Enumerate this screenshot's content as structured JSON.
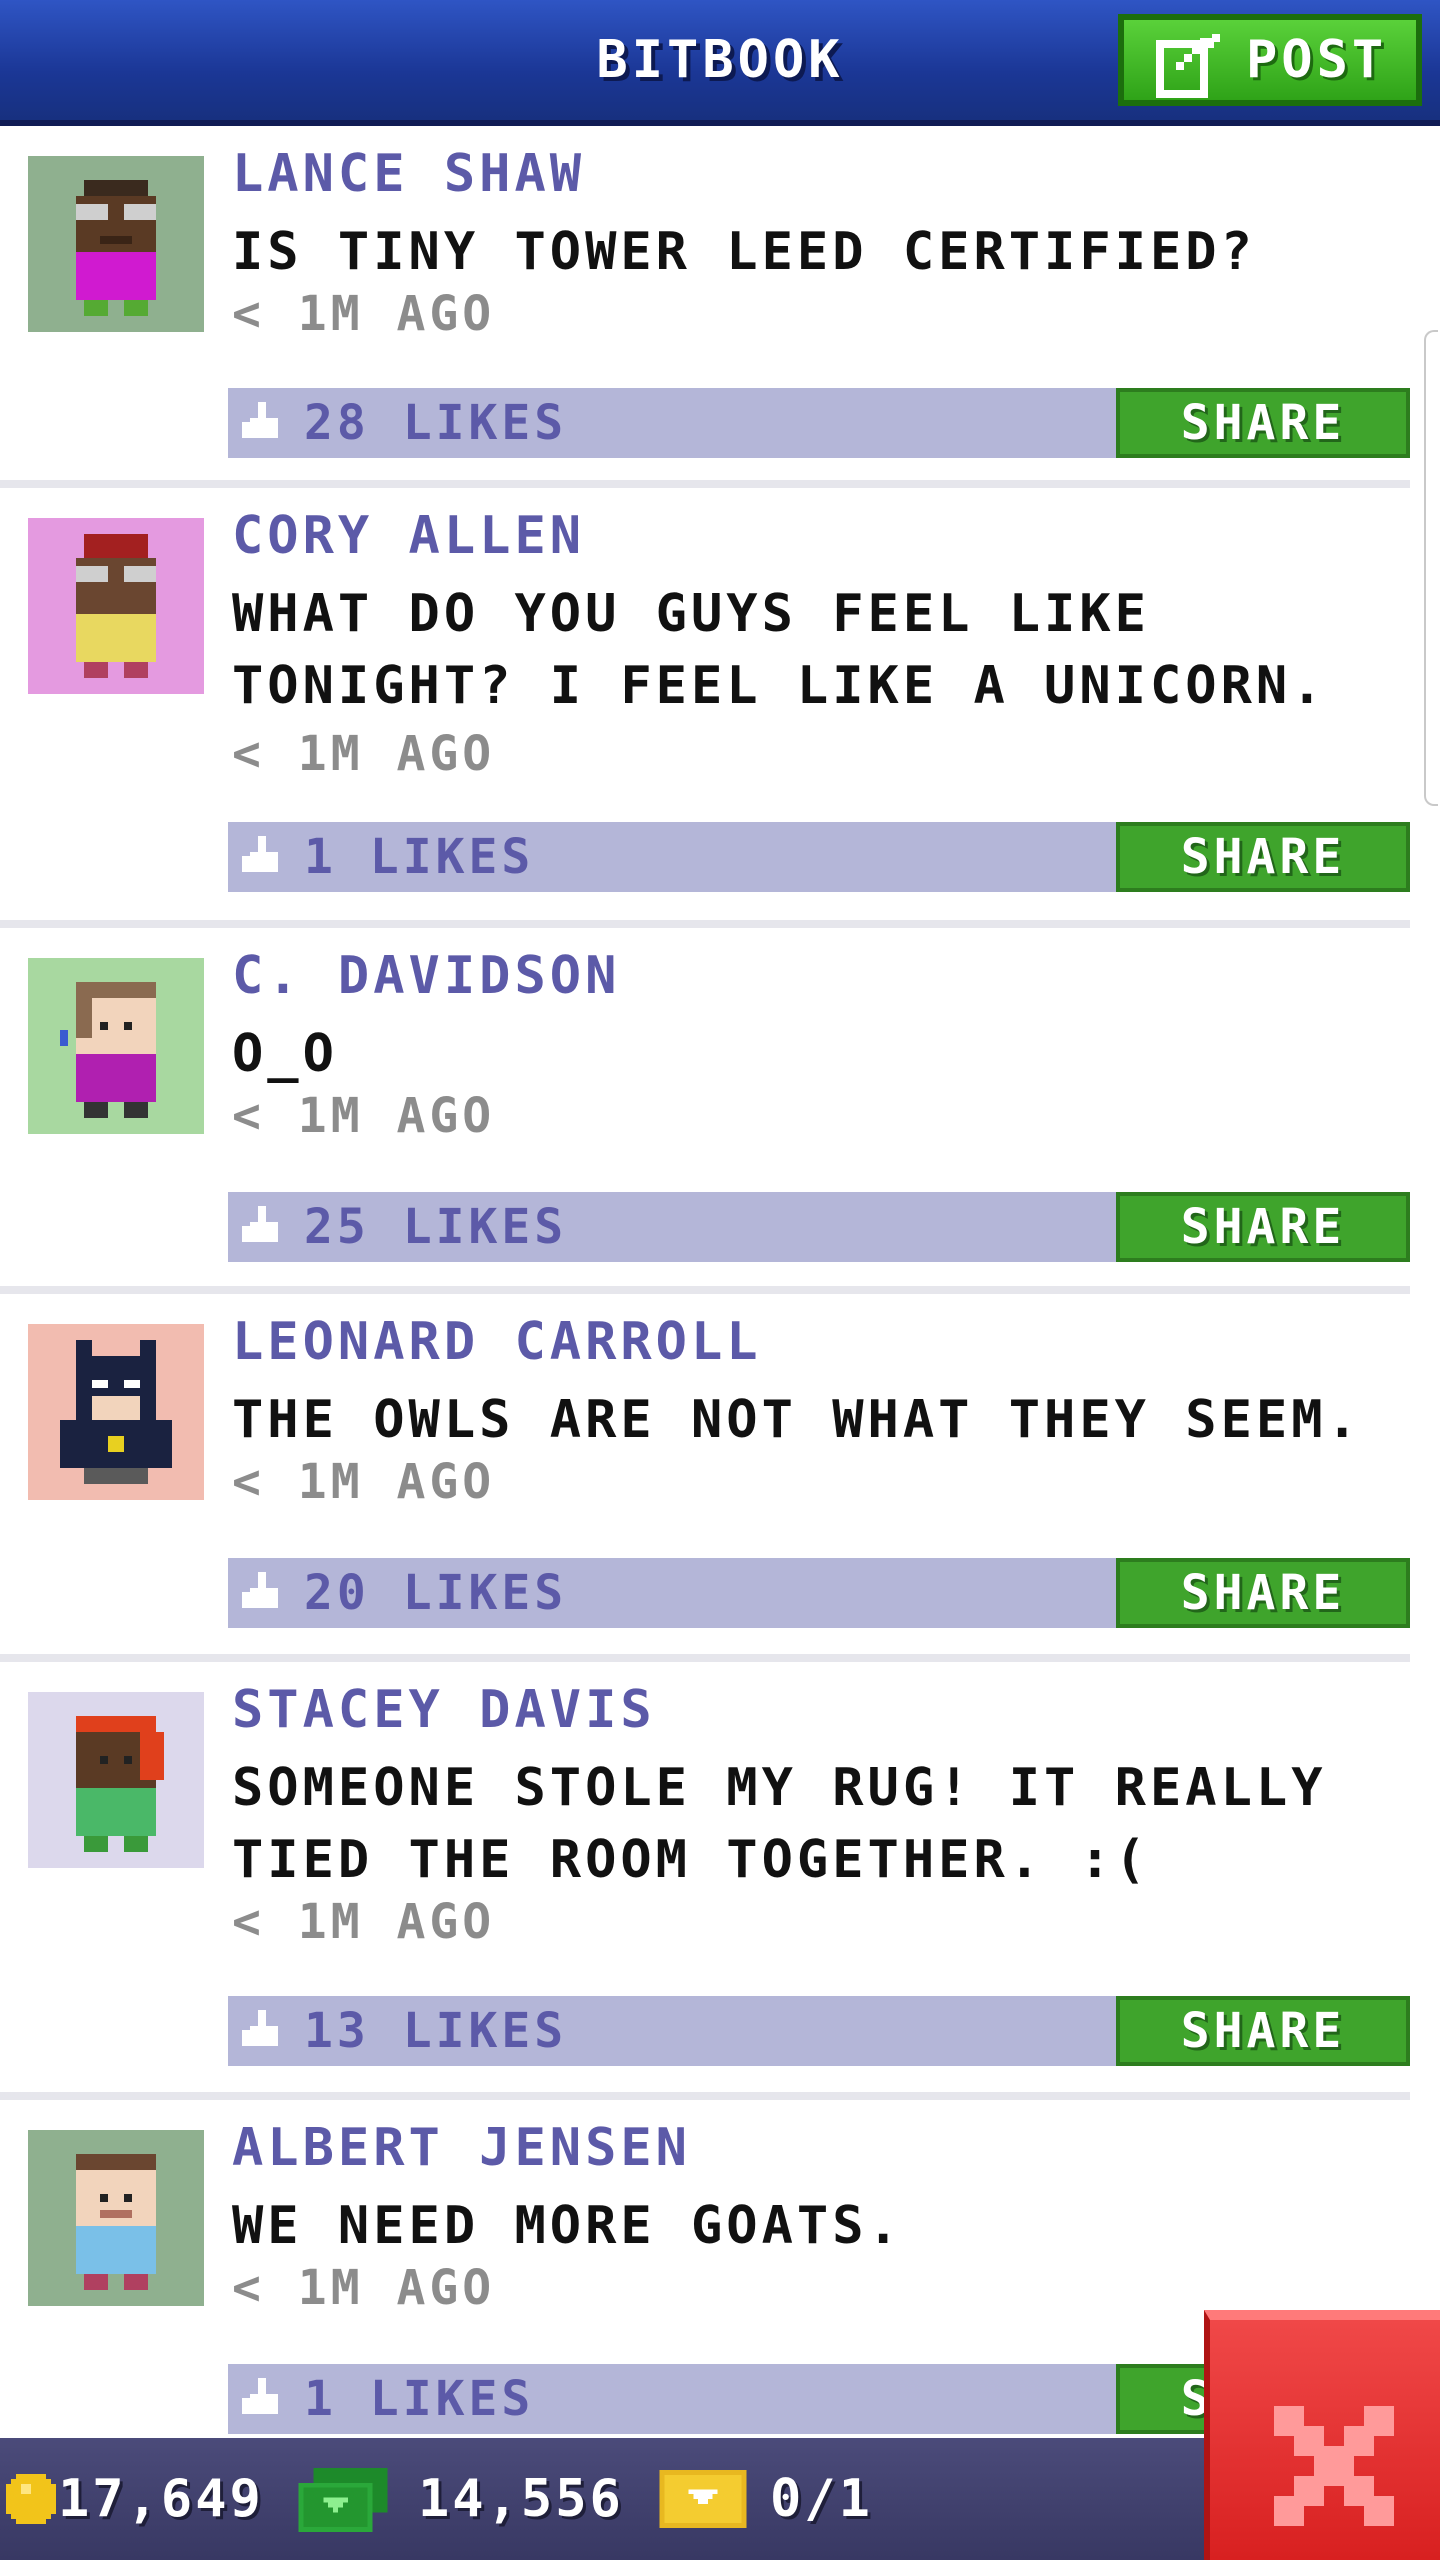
{
  "header": {
    "title": "BITBOOK",
    "post_label": "POST"
  },
  "posts": [
    {
      "author": "LANCE SHAW",
      "message": "IS TINY TOWER LEED CERTIFIED?",
      "time": "< 1M AGO",
      "likes": "28 LIKES",
      "share_label": "SHARE",
      "avatar_bg": "#8fb08f"
    },
    {
      "author": "CORY ALLEN",
      "message": "WHAT DO YOU GUYS FEEL LIKE TONIGHT? I FEEL LIKE A UNICORN.",
      "time": "< 1M AGO",
      "likes": "1 LIKES",
      "share_label": "SHARE",
      "avatar_bg": "#e49ae0"
    },
    {
      "author": "C. DAVIDSON",
      "message": "O_O",
      "time": "< 1M AGO",
      "likes": "25 LIKES",
      "share_label": "SHARE",
      "avatar_bg": "#a8d8a0"
    },
    {
      "author": "LEONARD CARROLL",
      "message": "THE OWLS ARE NOT WHAT THEY SEEM.",
      "time": "< 1M AGO",
      "likes": "20 LIKES",
      "share_label": "SHARE",
      "avatar_bg": "#f2bcb0"
    },
    {
      "author": "STACEY DAVIS",
      "message": "SOMEONE STOLE MY RUG! IT REALLY TIED THE ROOM TOGETHER. :(",
      "time": "< 1M AGO",
      "likes": "13 LIKES",
      "share_label": "SHARE",
      "avatar_bg": "#dcd8ec"
    },
    {
      "author": "ALBERT JENSEN",
      "message": "WE NEED MORE GOATS.",
      "time": "< 1M AGO",
      "likes": "1 LIKES",
      "share_label": "SHARE",
      "avatar_bg": "#8fb08f"
    }
  ],
  "footer": {
    "coins": "17,649",
    "bux": "14,556",
    "tickets": "0/1"
  }
}
